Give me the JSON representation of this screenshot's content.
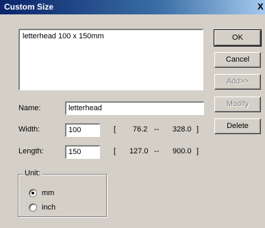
{
  "window": {
    "title": "Custom Size",
    "close_glyph": "X"
  },
  "list": {
    "items": [
      "letterhead 100 x 150mm"
    ]
  },
  "buttons": {
    "ok": "OK",
    "cancel": "Cancel",
    "add": "Add>>",
    "modify": "Modify",
    "delete": "Delete"
  },
  "form": {
    "name_label": "Name:",
    "name_value": "letterhead",
    "width_label": "Width:",
    "width_value": "100",
    "width_range": {
      "open": "[",
      "min": "76.2",
      "sep": "--",
      "max": "328.0",
      "close": "]"
    },
    "length_label": "Length:",
    "length_value": "150",
    "length_range": {
      "open": "[",
      "min": "127.0",
      "sep": "--",
      "max": "900.0",
      "close": "]"
    }
  },
  "unit": {
    "group_label": "Unit:",
    "options": [
      {
        "label": "mm",
        "selected": true
      },
      {
        "label": "inch",
        "selected": false
      }
    ]
  }
}
